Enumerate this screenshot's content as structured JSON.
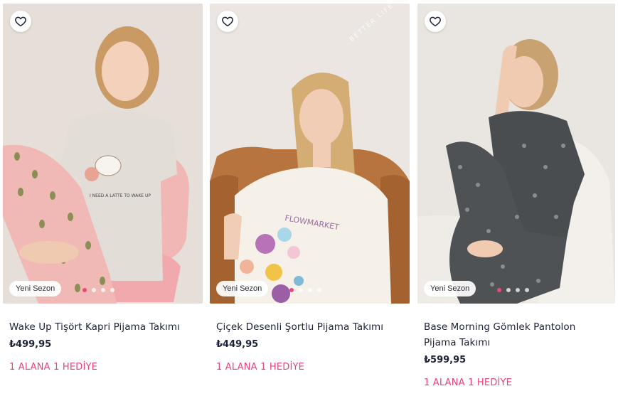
{
  "products": [
    {
      "name": "Wake Up Tişört Kapri Pijama Takımı",
      "price": "₺499,95",
      "promo": "1 ALANA 1 HEDİYE",
      "badge": "Yeni Sezon",
      "shirt_print": "I NEED A LATTE TO WAKE UP",
      "image_dots": 4,
      "active_dot": 1
    },
    {
      "name": "Çiçek Desenli Şortlu Pijama Takımı",
      "price": "₺449,95",
      "promo": "1 ALANA 1 HEDİYE",
      "badge": "Yeni Sezon",
      "shirt_print": "FLOWMARKET",
      "brand_mark": "BETTER LIFE",
      "image_dots": 4,
      "active_dot": 1
    },
    {
      "name": "Base Morning Gömlek Pantolon Pijama Takımı",
      "price": "₺599,95",
      "promo": "1 ALANA 1 HEDİYE",
      "badge": "Yeni Sezon",
      "image_dots": 4,
      "active_dot": 1
    }
  ],
  "colors": {
    "promo": "#e8437a",
    "price": "#1c2238",
    "active_dot": "#e84a7a"
  },
  "icons": {
    "favorite": "heart-outline-icon"
  }
}
